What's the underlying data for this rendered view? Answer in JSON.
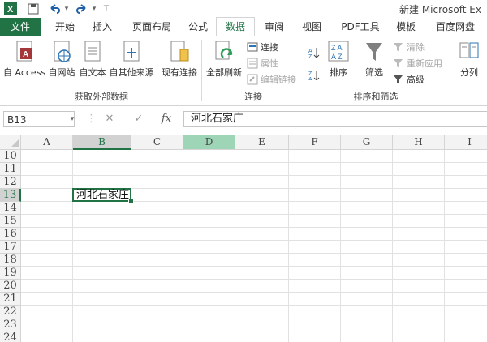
{
  "window": {
    "title": "新建 Microsoft Ex"
  },
  "tabs": [
    {
      "label": "文件",
      "file": true
    },
    {
      "label": "开始"
    },
    {
      "label": "插入"
    },
    {
      "label": "页面布局"
    },
    {
      "label": "公式"
    },
    {
      "label": "数据",
      "active": true
    },
    {
      "label": "审阅"
    },
    {
      "label": "视图"
    },
    {
      "label": "PDF工具"
    },
    {
      "label": "模板"
    },
    {
      "label": "百度网盘"
    }
  ],
  "ribbon": {
    "external": {
      "label": "获取外部数据",
      "access": "自 Access",
      "web": "自网站",
      "text": "自文本",
      "other": "自其他来源",
      "existing": "现有连接"
    },
    "connections": {
      "label": "连接",
      "refresh_all": "全部刷新",
      "connect": "连接",
      "properties": "属性",
      "edit_links": "编辑链接"
    },
    "sort_filter": {
      "label": "排序和筛选",
      "sort": "排序",
      "filter": "筛选",
      "clear": "清除",
      "reapply": "重新应用",
      "advanced": "高级"
    },
    "tools": {
      "split": "分列"
    }
  },
  "formula_bar": {
    "name_box": "B13",
    "cancel": "✕",
    "enter": "✓",
    "fx": "fx",
    "value": "河北石家庄"
  },
  "sheet": {
    "columns": [
      "A",
      "B",
      "C",
      "D",
      "E",
      "F",
      "G",
      "H",
      "I"
    ],
    "rows": [
      "10",
      "11",
      "12",
      "13",
      "14",
      "15",
      "16",
      "17",
      "18",
      "19",
      "20",
      "21",
      "22",
      "23",
      "24"
    ],
    "active_cell": "B13",
    "active_value": "河北石家庄"
  },
  "colors": {
    "accent": "#217346",
    "highlight_col": "#9fd5b7"
  }
}
